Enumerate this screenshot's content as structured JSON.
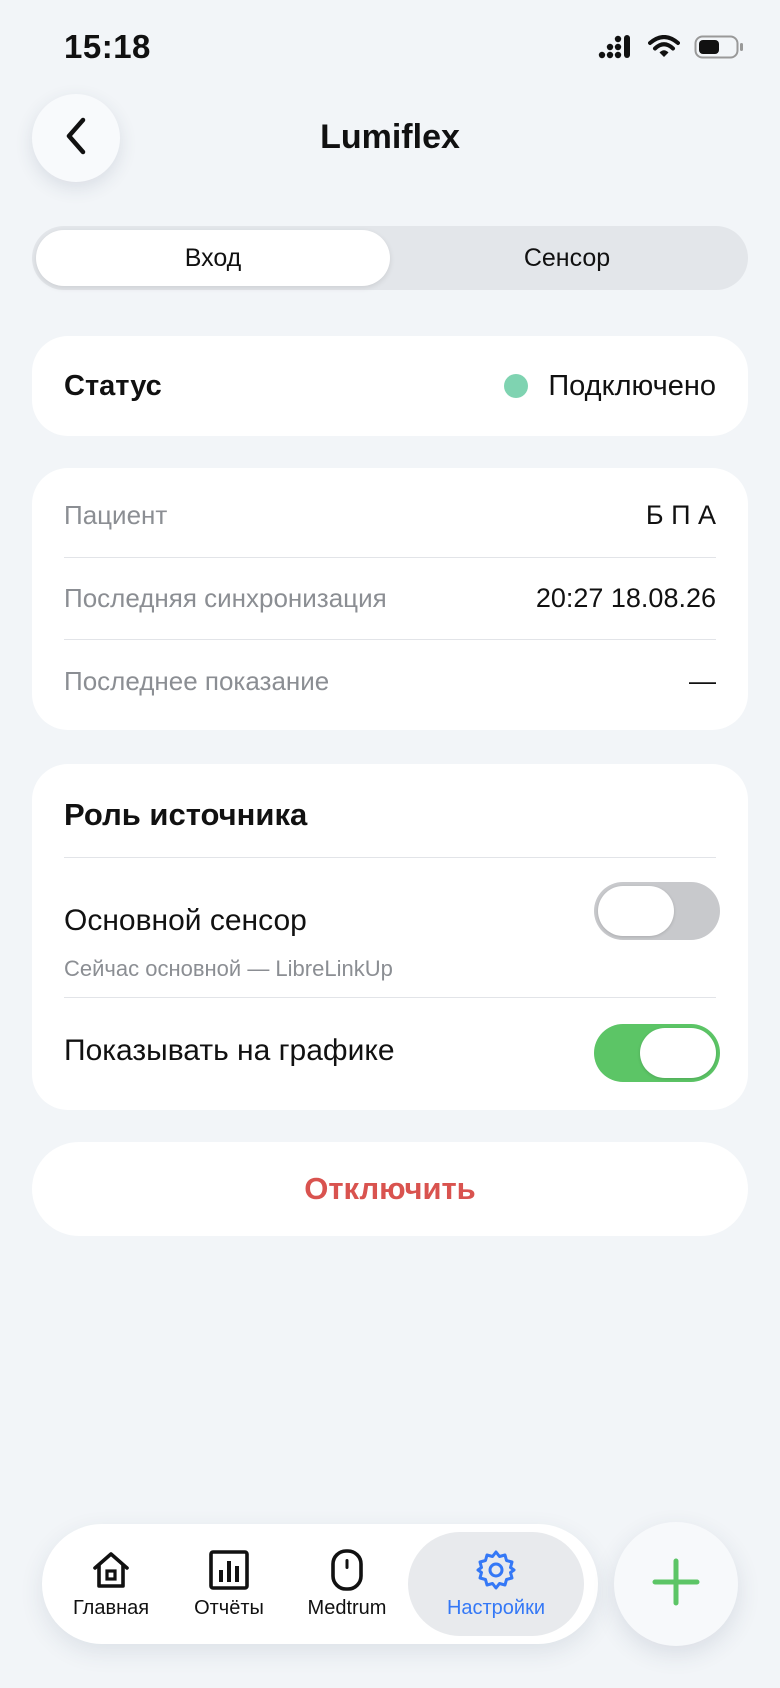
{
  "status_bar": {
    "time": "15:18"
  },
  "header": {
    "title": "Lumiflex"
  },
  "tabs": [
    {
      "label": "Вход",
      "active": true
    },
    {
      "label": "Сенсор",
      "active": false
    }
  ],
  "status": {
    "label": "Статус",
    "value": "Подключено",
    "indicator_color": "#7fd3b1"
  },
  "info": {
    "rows": [
      {
        "label": "Пациент",
        "value": "Б П А"
      },
      {
        "label": "Последняя синхронизация",
        "value": "20:27 18.08.26"
      },
      {
        "label": "Последнее показание",
        "value": "—"
      }
    ]
  },
  "source_role": {
    "title": "Роль источника",
    "primary_sensor": {
      "label": "Основной сенсор",
      "subtitle": "Сейчас основной — LibreLinkUp",
      "enabled": false
    },
    "show_on_chart": {
      "label": "Показывать на графике",
      "enabled": true
    }
  },
  "disconnect": {
    "label": "Отключить",
    "color": "#d9534f"
  },
  "bottom_nav": {
    "items": [
      {
        "label": "Главная",
        "icon": "home-icon",
        "active": false
      },
      {
        "label": "Отчёты",
        "icon": "bar-chart-icon",
        "active": false
      },
      {
        "label": "Medtrum",
        "icon": "device-icon",
        "active": false
      },
      {
        "label": "Настройки",
        "icon": "gear-icon",
        "active": true
      }
    ],
    "active_color": "#3478f6"
  },
  "add_button": {
    "icon": "plus-icon",
    "color": "#5cc566"
  }
}
